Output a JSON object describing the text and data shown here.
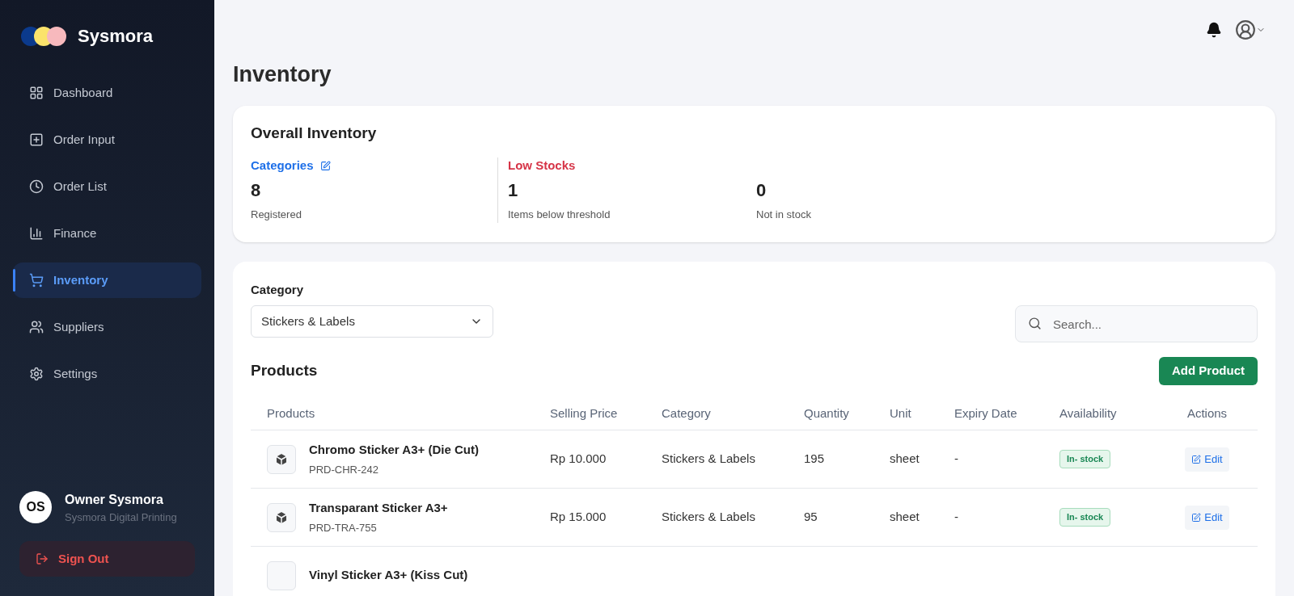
{
  "brand": {
    "name": "Sysmora"
  },
  "nav": [
    {
      "label": "Dashboard",
      "selected": false
    },
    {
      "label": "Order Input",
      "selected": false
    },
    {
      "label": "Order List",
      "selected": false
    },
    {
      "label": "Finance",
      "selected": false
    },
    {
      "label": "Inventory",
      "selected": true
    },
    {
      "label": "Suppliers",
      "selected": false
    },
    {
      "label": "Settings",
      "selected": false
    }
  ],
  "user": {
    "initials": "OS",
    "name": "Owner Sysmora",
    "company": "Sysmora Digital Printing"
  },
  "sign_out": "Sign Out",
  "page_title": "Inventory",
  "overall": {
    "title": "Overall Inventory",
    "stats": [
      {
        "kind": "categories",
        "label": "Categories",
        "value": "8",
        "caption": "Registered"
      },
      {
        "kind": "low",
        "label": "Low Stocks",
        "value": "1",
        "caption": "Items below threshold"
      },
      {
        "kind": "plain",
        "value": "0",
        "caption": "Not in stock"
      }
    ]
  },
  "filter": {
    "label": "Category",
    "value": "Stickers & Labels"
  },
  "search": {
    "placeholder": "Search..."
  },
  "products": {
    "title": "Products",
    "add_button": "Add Product",
    "columns": [
      "Products",
      "Selling Price",
      "Category",
      "Quantity",
      "Unit",
      "Expiry Date",
      "Availability",
      "Actions"
    ],
    "rows": [
      {
        "name": "Chromo Sticker A3+ (Die Cut)",
        "code": "PRD-CHR-242",
        "price": "Rp 10.000",
        "category": "Stickers & Labels",
        "quantity": "195",
        "unit": "sheet",
        "expiry": "-",
        "availability": "In- stock",
        "action": "Edit"
      },
      {
        "name": "Transparant Sticker A3+",
        "code": "PRD-TRA-755",
        "price": "Rp 15.000",
        "category": "Stickers & Labels",
        "quantity": "95",
        "unit": "sheet",
        "expiry": "-",
        "availability": "In- stock",
        "action": "Edit"
      },
      {
        "name": "Vinyl Sticker A3+ (Kiss Cut)"
      }
    ]
  }
}
